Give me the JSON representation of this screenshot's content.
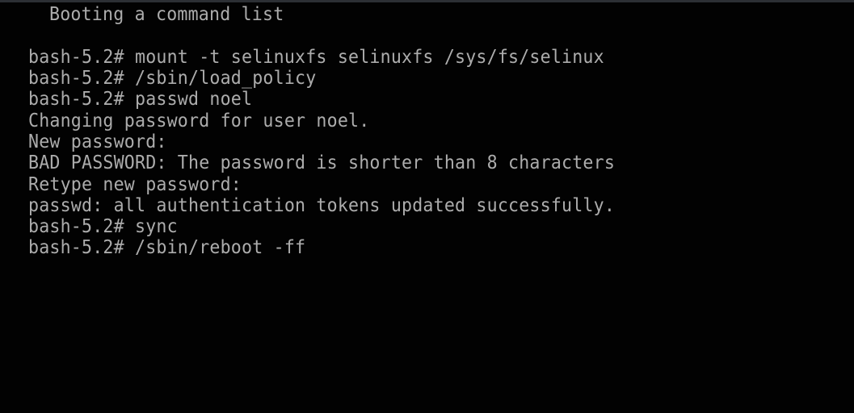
{
  "console": {
    "header": "Booting a command list",
    "lines": [
      "bash-5.2# mount -t selinuxfs selinuxfs /sys/fs/selinux",
      "bash-5.2# /sbin/load_policy",
      "bash-5.2# passwd noel",
      "Changing password for user noel.",
      "New password:",
      "BAD PASSWORD: The password is shorter than 8 characters",
      "Retype new password:",
      "passwd: all authentication tokens updated successfully.",
      "bash-5.2# sync",
      "bash-5.2# /sbin/reboot -ff"
    ],
    "prompt": "bash-5.2#",
    "colors": {
      "background": "#000000",
      "foreground": "#acacac",
      "top_border": "#2c2f34"
    }
  }
}
